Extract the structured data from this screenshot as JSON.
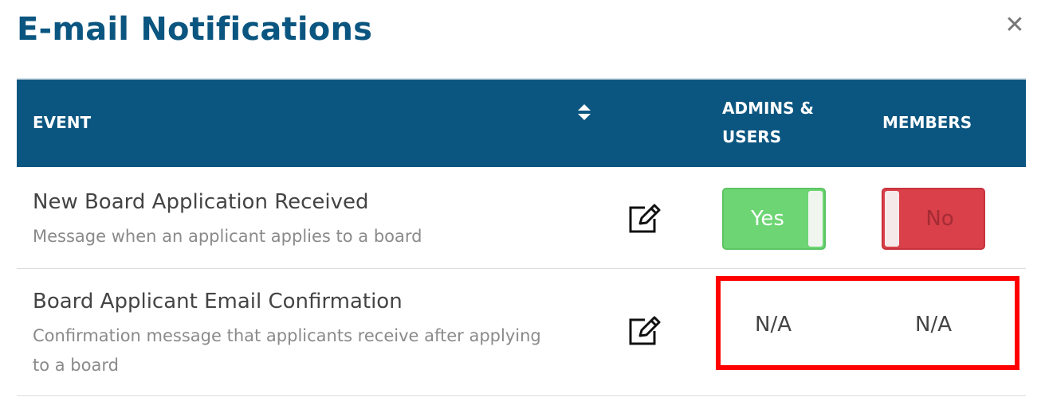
{
  "dialog": {
    "title": "E-mail Notifications",
    "close_icon": "close-icon"
  },
  "table": {
    "columns": {
      "event": "EVENT",
      "admins_users": "ADMINS & USERS",
      "members": "MEMBERS"
    },
    "sort_icon": "sort-icon",
    "rows": [
      {
        "title": "New Board Application Received",
        "description": "Message when an applicant applies to a board",
        "edit_icon": "edit-icon",
        "admins_users": {
          "type": "toggle",
          "value": "Yes",
          "on": true
        },
        "members": {
          "type": "toggle",
          "value": "No",
          "on": false
        }
      },
      {
        "title": "Board Applicant Email Confirmation",
        "description": "Confirmation message that applicants receive after applying to a board",
        "edit_icon": "edit-icon",
        "admins_users": {
          "type": "text",
          "value": "N/A"
        },
        "members": {
          "type": "text",
          "value": "N/A"
        }
      }
    ]
  },
  "colors": {
    "brand": "#0b5680",
    "toggle_on": "#6dd573",
    "toggle_off": "#d94049",
    "highlight": "#ff0000"
  }
}
